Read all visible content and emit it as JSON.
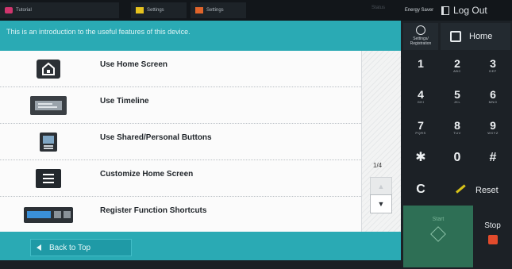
{
  "topbar": {
    "tab1_label": "Tutorial",
    "tab2_label": "Settings",
    "tab3_label": "Settings",
    "status_label": "Status",
    "energy_saver_label": "Energy Saver",
    "logout_label": "Log Out"
  },
  "main": {
    "banner_text": "This is an introduction to the useful features of this device.",
    "items": [
      {
        "label": "Use Home Screen",
        "icon": "home-screen-icon"
      },
      {
        "label": "Use Timeline",
        "icon": "timeline-icon"
      },
      {
        "label": "Use Shared/Personal Buttons",
        "icon": "shared-buttons-icon"
      },
      {
        "label": "Customize Home Screen",
        "icon": "customize-icon"
      },
      {
        "label": "Register Function Shortcuts",
        "icon": "shortcuts-icon"
      }
    ],
    "page_indicator": "1/4",
    "back_label": "Back to Top"
  },
  "side": {
    "settings_label_line1": "Settings/",
    "settings_label_line2": "Registration",
    "home_label": "Home",
    "keys": [
      {
        "num": "1",
        "sub": ""
      },
      {
        "num": "2",
        "sub": "ABC"
      },
      {
        "num": "3",
        "sub": "DEF"
      },
      {
        "num": "4",
        "sub": "GHI"
      },
      {
        "num": "5",
        "sub": "JKL"
      },
      {
        "num": "6",
        "sub": "MNO"
      },
      {
        "num": "7",
        "sub": "PQRS"
      },
      {
        "num": "8",
        "sub": "TUV"
      },
      {
        "num": "9",
        "sub": "WXYZ"
      },
      {
        "num": "✱",
        "sub": ""
      },
      {
        "num": "0",
        "sub": ""
      },
      {
        "num": "#",
        "sub": ""
      },
      {
        "num": "C",
        "sub": ""
      }
    ],
    "reset_label": "Reset",
    "start_label": "Start",
    "stop_label": "Stop"
  },
  "colors": {
    "accent": "#2aaab4",
    "start_green": "#2e6f55",
    "stop_red": "#e24b2c",
    "reset_yellow": "#d8c319"
  }
}
